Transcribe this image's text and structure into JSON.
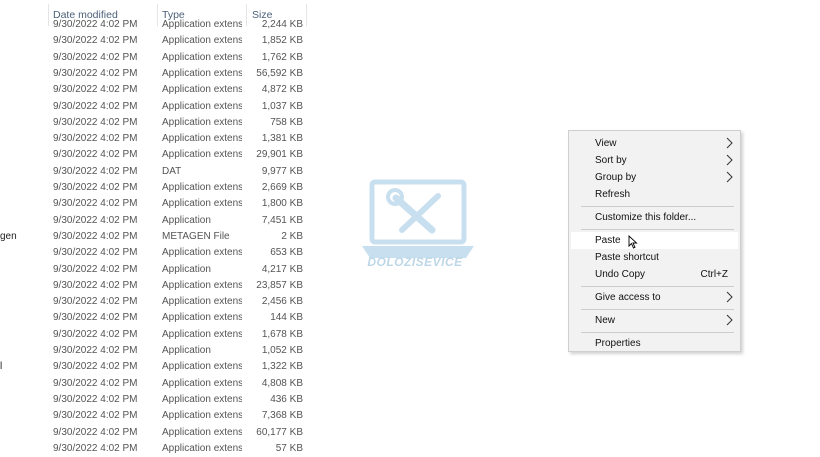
{
  "columns": {
    "date": "Date modified",
    "type": "Type",
    "size": "Size"
  },
  "rows": [
    {
      "name": "",
      "date": "9/30/2022 4:02 PM",
      "type": "Application extens...",
      "size": "2,244 KB"
    },
    {
      "name": "",
      "date": "9/30/2022 4:02 PM",
      "type": "Application extens...",
      "size": "1,852 KB"
    },
    {
      "name": "",
      "date": "9/30/2022 4:02 PM",
      "type": "Application extens...",
      "size": "1,762 KB"
    },
    {
      "name": "",
      "date": "9/30/2022 4:02 PM",
      "type": "Application extens...",
      "size": "56,592 KB"
    },
    {
      "name": "",
      "date": "9/30/2022 4:02 PM",
      "type": "Application extens...",
      "size": "4,872 KB"
    },
    {
      "name": "",
      "date": "9/30/2022 4:02 PM",
      "type": "Application extens...",
      "size": "1,037 KB"
    },
    {
      "name": "",
      "date": "9/30/2022 4:02 PM",
      "type": "Application extens...",
      "size": "758 KB"
    },
    {
      "name": "",
      "date": "9/30/2022 4:02 PM",
      "type": "Application extens...",
      "size": "1,381 KB"
    },
    {
      "name": "",
      "date": "9/30/2022 4:02 PM",
      "type": "Application extens...",
      "size": "29,901 KB"
    },
    {
      "name": "",
      "date": "9/30/2022 4:02 PM",
      "type": "DAT",
      "size": "9,977 KB"
    },
    {
      "name": "",
      "date": "9/30/2022 4:02 PM",
      "type": "Application extens...",
      "size": "2,669 KB"
    },
    {
      "name": "",
      "date": "9/30/2022 4:02 PM",
      "type": "Application extens...",
      "size": "1,800 KB"
    },
    {
      "name": "",
      "date": "9/30/2022 4:02 PM",
      "type": "Application",
      "size": "7,451 KB"
    },
    {
      "name": "gen",
      "date": "9/30/2022 4:02 PM",
      "type": "METAGEN File",
      "size": "2 KB"
    },
    {
      "name": "",
      "date": "9/30/2022 4:02 PM",
      "type": "Application extens...",
      "size": "653 KB"
    },
    {
      "name": "",
      "date": "9/30/2022 4:02 PM",
      "type": "Application",
      "size": "4,217 KB"
    },
    {
      "name": "",
      "date": "9/30/2022 4:02 PM",
      "type": "Application extens...",
      "size": "23,857 KB"
    },
    {
      "name": "",
      "date": "9/30/2022 4:02 PM",
      "type": "Application extens...",
      "size": "2,456 KB"
    },
    {
      "name": "",
      "date": "9/30/2022 4:02 PM",
      "type": "Application extens...",
      "size": "144 KB"
    },
    {
      "name": "",
      "date": "9/30/2022 4:02 PM",
      "type": "Application extens...",
      "size": "1,678 KB"
    },
    {
      "name": "",
      "date": "9/30/2022 4:02 PM",
      "type": "Application",
      "size": "1,052 KB"
    },
    {
      "name": "l",
      "date": "9/30/2022 4:02 PM",
      "type": "Application extens...",
      "size": "1,322 KB"
    },
    {
      "name": "",
      "date": "9/30/2022 4:02 PM",
      "type": "Application extens...",
      "size": "4,808 KB"
    },
    {
      "name": "",
      "date": "9/30/2022 4:02 PM",
      "type": "Application extens...",
      "size": "436 KB"
    },
    {
      "name": "",
      "date": "9/30/2022 4:02 PM",
      "type": "Application extens...",
      "size": "7,368 KB"
    },
    {
      "name": "",
      "date": "9/30/2022 4:02 PM",
      "type": "Application extens...",
      "size": "60,177 KB"
    },
    {
      "name": "",
      "date": "9/30/2022 4:02 PM",
      "type": "Application extens...",
      "size": "57 KB"
    }
  ],
  "context_menu": {
    "items": [
      {
        "label": "View",
        "shortcut": "",
        "submenu": true,
        "hover": false
      },
      {
        "label": "Sort by",
        "shortcut": "",
        "submenu": true,
        "hover": false
      },
      {
        "label": "Group by",
        "shortcut": "",
        "submenu": true,
        "hover": false
      },
      {
        "label": "Refresh",
        "shortcut": "",
        "submenu": false,
        "hover": false
      },
      {
        "separator": true
      },
      {
        "label": "Customize this folder...",
        "shortcut": "",
        "submenu": false,
        "hover": false
      },
      {
        "separator": true
      },
      {
        "label": "Paste",
        "shortcut": "",
        "submenu": false,
        "hover": true
      },
      {
        "label": "Paste shortcut",
        "shortcut": "",
        "submenu": false,
        "hover": false
      },
      {
        "label": "Undo Copy",
        "shortcut": "Ctrl+Z",
        "submenu": false,
        "hover": false
      },
      {
        "separator": true
      },
      {
        "label": "Give access to",
        "shortcut": "",
        "submenu": true,
        "hover": false
      },
      {
        "separator": true
      },
      {
        "label": "New",
        "shortcut": "",
        "submenu": true,
        "hover": false
      },
      {
        "separator": true
      },
      {
        "label": "Properties",
        "shortcut": "",
        "submenu": false,
        "hover": false
      }
    ]
  },
  "watermark": {
    "text": "DOLOZISEVICE",
    "icon": "laptop-tools-icon"
  },
  "colors": {
    "menu_bg": "#f2f2f2",
    "menu_hover": "#ffffff",
    "header_text": "#4c607a",
    "watermark": "#9cc6e3"
  }
}
